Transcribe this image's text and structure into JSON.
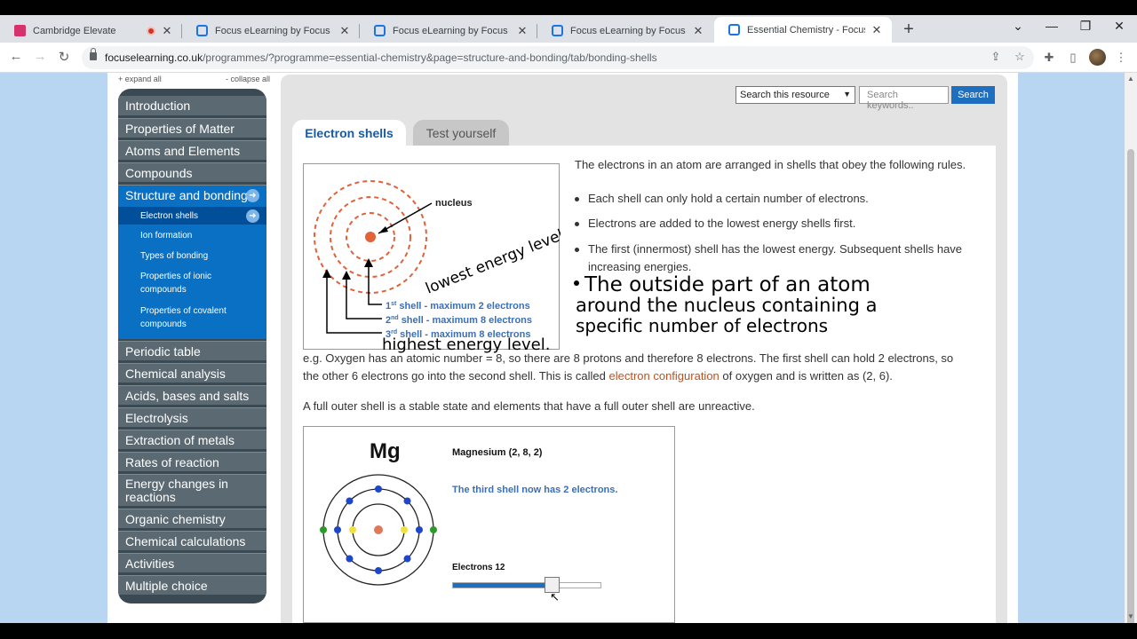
{
  "browser": {
    "tabs": [
      {
        "title": "Cambridge Elevate",
        "active": false
      },
      {
        "title": "Focus eLearning by Focus Educat",
        "active": false
      },
      {
        "title": "Focus eLearning by Focus Educat",
        "active": false
      },
      {
        "title": "Focus eLearning by Focus Educat",
        "active": false
      },
      {
        "title": "Essential Chemistry - Focus eLea",
        "active": true
      }
    ],
    "url_host": "focuselearning.co.uk",
    "url_path": "/programmes/?programme=essential-chemistry&page=structure-and-bonding/tab/bonding-shells"
  },
  "sidebar": {
    "expand_all": "+ expand all",
    "collapse_all": "- collapse all",
    "items": [
      {
        "label": "Introduction"
      },
      {
        "label": "Properties of Matter"
      },
      {
        "label": "Atoms and Elements"
      },
      {
        "label": "Compounds"
      },
      {
        "label": "Structure and bonding"
      },
      {
        "label": "Periodic table"
      },
      {
        "label": "Chemical analysis"
      },
      {
        "label": "Acids, bases and salts"
      },
      {
        "label": "Electrolysis"
      },
      {
        "label": "Extraction of metals"
      },
      {
        "label": "Rates of reaction"
      },
      {
        "label": "Energy changes in reactions"
      },
      {
        "label": "Organic chemistry"
      },
      {
        "label": "Chemical calculations"
      },
      {
        "label": "Activities"
      },
      {
        "label": "Multiple choice"
      }
    ],
    "subitems": [
      {
        "label": "Electron shells"
      },
      {
        "label": "Ion formation"
      },
      {
        "label": "Types of bonding"
      },
      {
        "label": "Properties of ionic compounds"
      },
      {
        "label": "Properties of covalent compounds"
      }
    ]
  },
  "search": {
    "select_value": "Search this resource",
    "placeholder": "Search keywords..",
    "button": "Search"
  },
  "content_tabs": [
    "Electron shells",
    "Test yourself"
  ],
  "diagram1": {
    "nucleus_label": "nucleus",
    "shell1": "shell - maximum 2 electrons",
    "shell2": "shell - maximum 8 electrons",
    "shell3": "shell - maximum 8 electrons",
    "ord1": "1",
    "sup1": "st",
    "ord2": "2",
    "sup2": "nd",
    "ord3": "3",
    "sup3": "rd",
    "hand_lowest": "lowest energy level.",
    "hand_highest": "highest energy level."
  },
  "body": {
    "intro": "The electrons in an atom are arranged in shells that obey the following rules.",
    "bullets": [
      "Each shell can only hold a certain number of electrons.",
      "Electrons are added to the lowest energy shells first.",
      "The first (innermost) shell has the lowest energy. Subsequent shells have",
      "increasing energies."
    ],
    "handwritten_note": [
      "The outside part of an atom",
      "around the nucleus containing a",
      "specific number of electrons"
    ],
    "example_1": "e.g. Oxygen has an atomic number = 8, so there are 8 protons and therefore 8 electrons. The first shell can hold 2 electrons, so",
    "example_2a": "the other 6 electrons go into the second shell. This is called",
    "example_link": "electron configuration",
    "example_2b": "of oxygen and is written as (2, 6).",
    "full_shell": "A full outer shell is a stable state and elements that have a full outer shell are unreactive."
  },
  "diagram2": {
    "symbol": "Mg",
    "name": "Magnesium (2, 8, 2)",
    "message": "The third shell now has 2 electrons.",
    "electrons_label": "Electrons 12",
    "electrons": 12,
    "electrons_max": 18
  },
  "colors": {
    "nav_bg": "#5b6a72",
    "nav_active": "#0a70c4",
    "accent_blue": "#1f6fc0",
    "shell_orange": "#e0613a",
    "link_orange": "#c0501e"
  }
}
